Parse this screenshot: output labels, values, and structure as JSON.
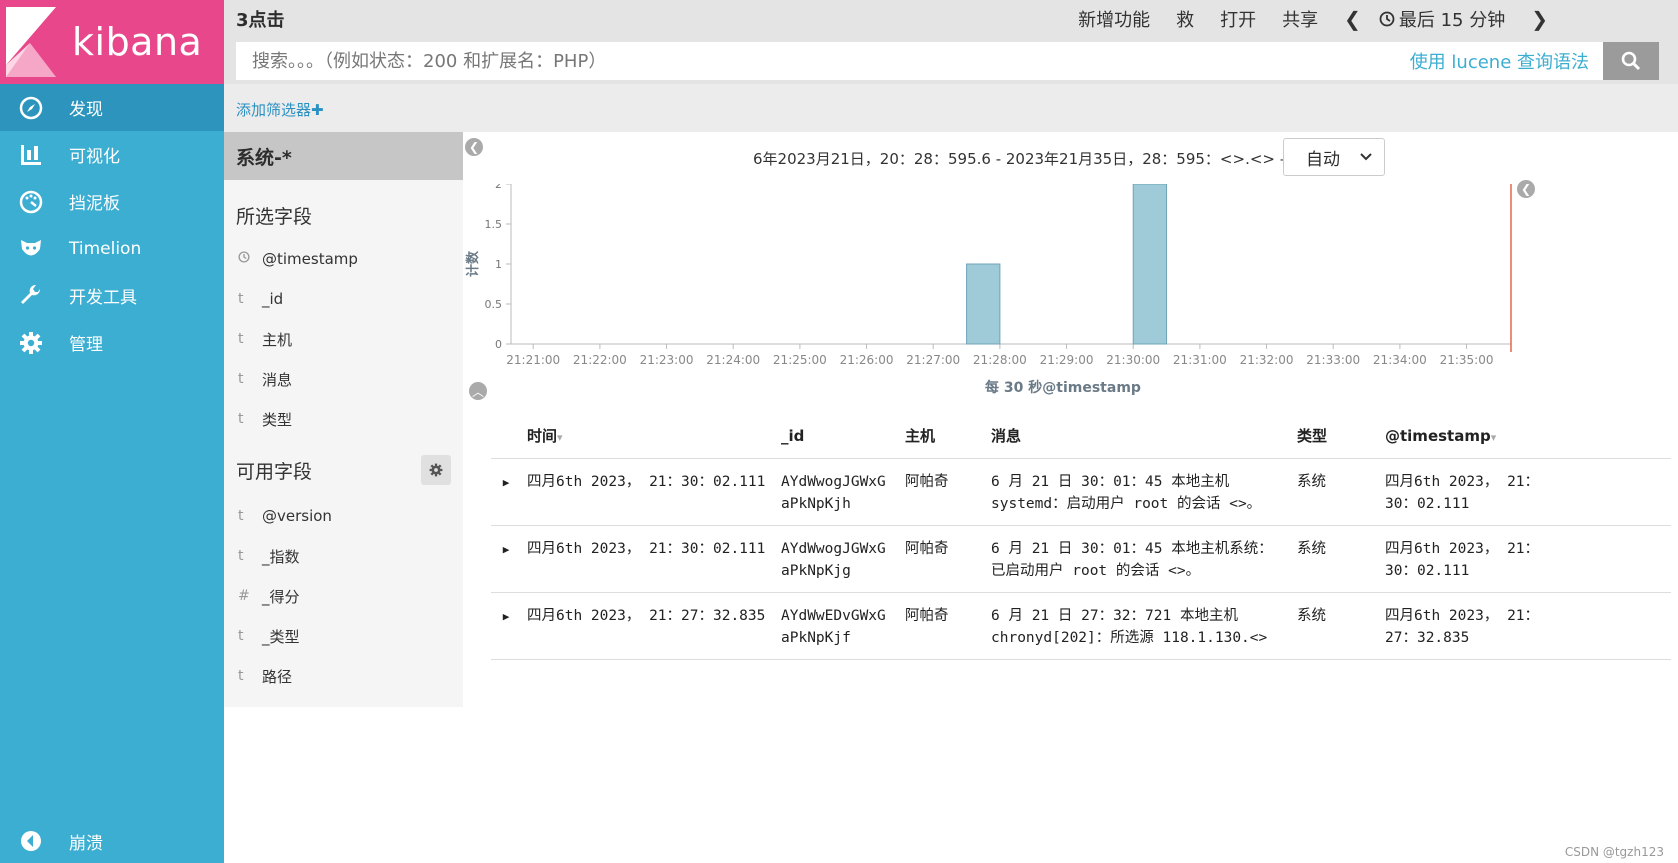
{
  "brand": {
    "name": "kibana",
    "accent": "#e8488b",
    "nav_color": "#3caed2"
  },
  "nav": {
    "items": [
      {
        "label": "发现",
        "icon": "compass-icon"
      },
      {
        "label": "可视化",
        "icon": "bar-chart-icon"
      },
      {
        "label": "挡泥板",
        "icon": "dashboard-icon"
      },
      {
        "label": "Timelion",
        "icon": "timelion-icon"
      },
      {
        "label": "开发工具",
        "icon": "wrench-icon"
      },
      {
        "label": "管理",
        "icon": "gear-icon"
      }
    ],
    "collapse_label": "崩溃"
  },
  "topbar": {
    "title": "3点击",
    "menu": {
      "new": "新增功能",
      "save": "救",
      "open": "打开",
      "share": "共享",
      "time": "最后 15 分钟"
    }
  },
  "search": {
    "placeholder": "搜索。。。（例如状态：200 和扩展名：PHP）",
    "lucene_link": "使用 lucene 查询语法"
  },
  "filter": {
    "add_label": "添加筛选器",
    "plus": "✚"
  },
  "sidebar": {
    "index_pattern": "系统-*",
    "selected_title": "所选字段",
    "selected_fields": [
      {
        "type": "clock",
        "name": "@timestamp"
      },
      {
        "type": "t",
        "name": "_id"
      },
      {
        "type": "t",
        "name": "主机"
      },
      {
        "type": "t",
        "name": "消息"
      },
      {
        "type": "t",
        "name": "类型"
      }
    ],
    "available_title": "可用字段",
    "available_fields": [
      {
        "type": "t",
        "name": "@version"
      },
      {
        "type": "t",
        "name": "_指数"
      },
      {
        "type": "#",
        "name": "_得分"
      },
      {
        "type": "t",
        "name": "_类型"
      },
      {
        "type": "t",
        "name": "路径"
      }
    ]
  },
  "main": {
    "time_range": "6年2023月21日，20：28：595.6 - 2023年21月35日，28：595：<>.<> —",
    "interval": "自动"
  },
  "chart_data": {
    "type": "bar",
    "x_ticks": [
      "21:21:00",
      "21:22:00",
      "21:23:00",
      "21:24:00",
      "21:25:00",
      "21:26:00",
      "21:27:00",
      "21:28:00",
      "21:29:00",
      "21:30:00",
      "21:31:00",
      "21:32:00",
      "21:33:00",
      "21:34:00",
      "21:35:00"
    ],
    "y_ticks": [
      "0",
      "0.5",
      "1",
      "1.5",
      "2"
    ],
    "ylim": [
      0,
      2
    ],
    "x_range": [
      "21:20:40",
      "21:35:40"
    ],
    "bars": [
      {
        "x": "21:27:30",
        "value": 1
      },
      {
        "x": "21:30:00",
        "value": 2
      }
    ],
    "bar_width_seconds": 30,
    "ylabel": "计数",
    "xlabel": "每 30 秒@timestamp",
    "bar_color": "#9fcad8",
    "now_marker_color": "#e7664c"
  },
  "table": {
    "headers": [
      "时间",
      "_id",
      "主机",
      "消息",
      "类型",
      "@timestamp"
    ],
    "rows": [
      {
        "time": "四月6th 2023， 21：30：02.111",
        "id": [
          "AYdWwogJGWxG",
          "aPkNpKjh"
        ],
        "host": "阿帕奇",
        "message": [
          "6 月 21 日 30：01：45 本地主机",
          "systemd：启动用户 root 的会话 <>。"
        ],
        "type": "系统",
        "timestamp": [
          "四月6th 2023， 21：",
          "30：02.111"
        ]
      },
      {
        "time": "四月6th 2023， 21：30：02.111",
        "id": [
          "AYdWwogJGWxG",
          "aPkNpKjg"
        ],
        "host": "阿帕奇",
        "message": [
          "6 月 21 日 30：01：45 本地主机系统：",
          "已启动用户 root 的会话 <>。"
        ],
        "type": "系统",
        "timestamp": [
          "四月6th 2023， 21：",
          "30：02.111"
        ]
      },
      {
        "time": "四月6th 2023， 21：27：32.835",
        "id": [
          "AYdWwEDvGWxG",
          "aPkNpKjf"
        ],
        "host": "阿帕奇",
        "message": [
          "6 月 21 日 27：32：721 本地主机",
          "chronyd[202]：所选源 118.1.130.<>"
        ],
        "type": "系统",
        "timestamp": [
          "四月6th 2023， 21：",
          "27：32.835"
        ]
      }
    ]
  },
  "watermark": "CSDN @tgzh123"
}
